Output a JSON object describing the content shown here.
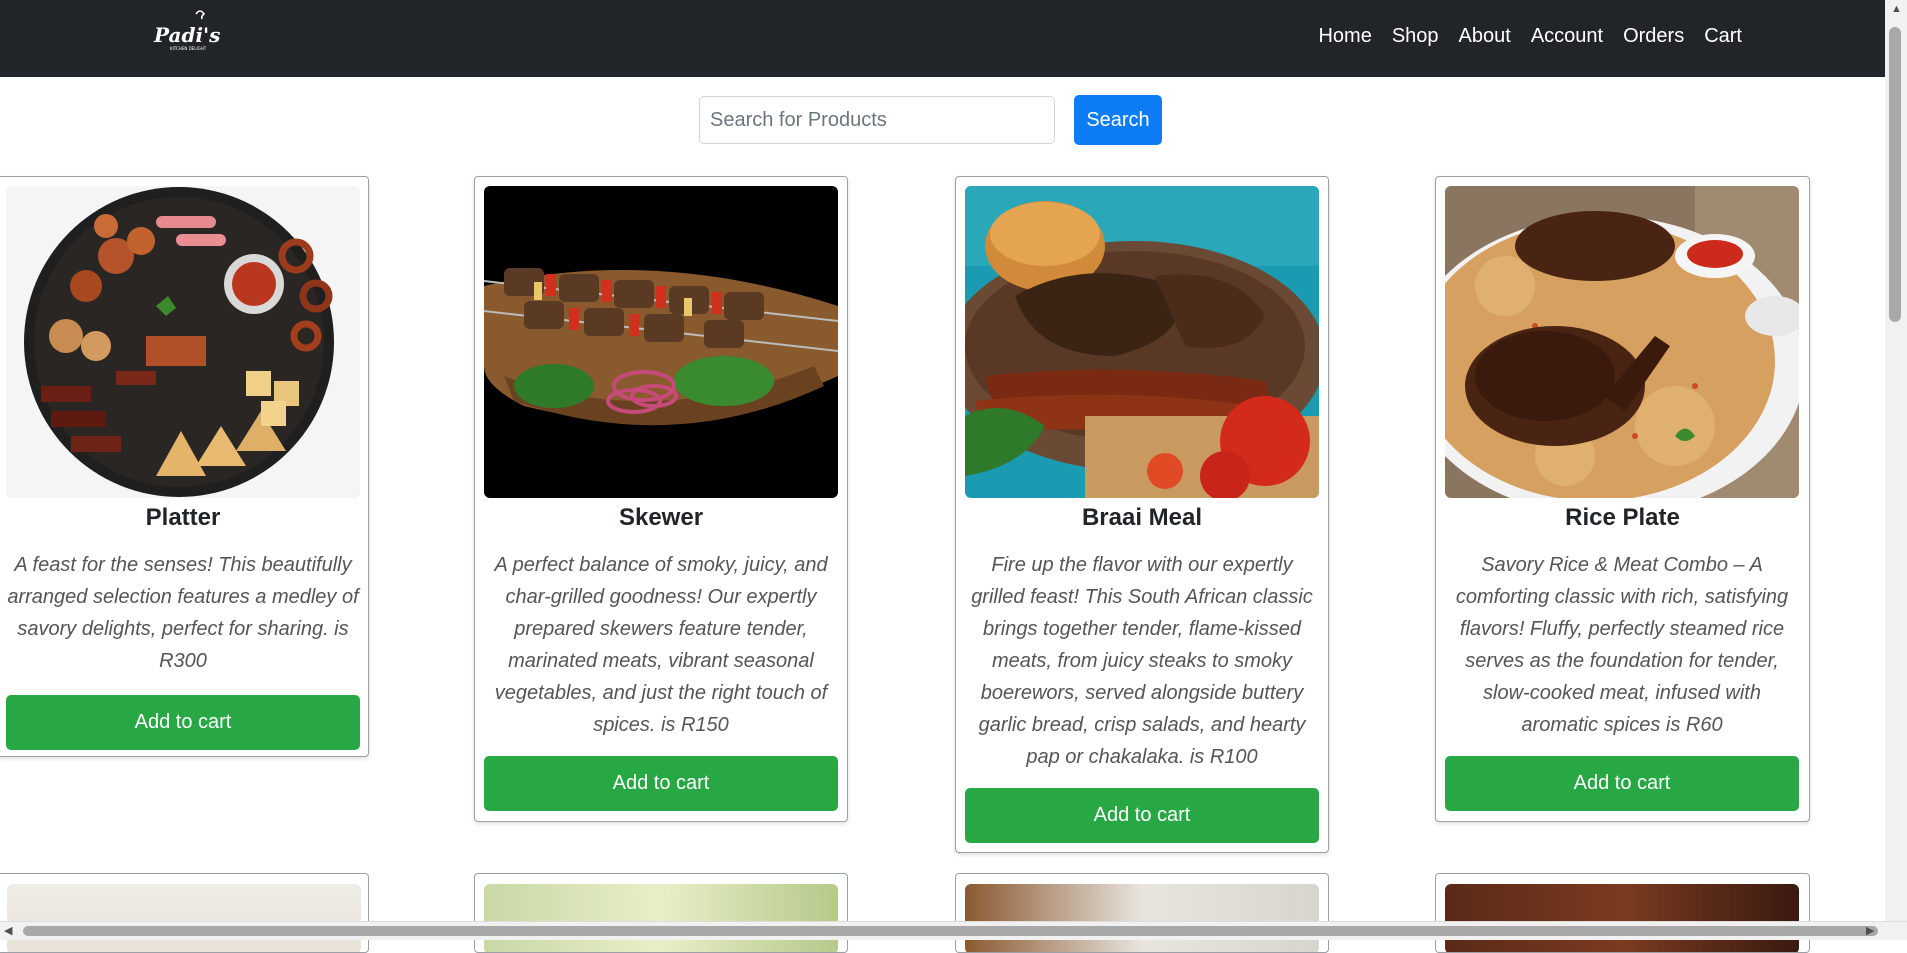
{
  "nav": {
    "logo_text": "Padi's",
    "links": [
      "Home",
      "Shop",
      "About",
      "Account",
      "Orders",
      "Cart"
    ]
  },
  "search": {
    "placeholder": "Search for Products",
    "button_label": "Search"
  },
  "products": [
    {
      "title": "Platter",
      "description": "A feast for the senses! This beautifully arranged selection features a medley of savory delights, perfect for sharing. is R300",
      "button": "Add to cart"
    },
    {
      "title": "Skewer",
      "description": "A perfect balance of smoky, juicy, and char-grilled goodness! Our expertly prepared skewers feature tender, marinated meats, vibrant seasonal vegetables, and just the right touch of spices. is R150",
      "button": "Add to cart"
    },
    {
      "title": "Braai Meal",
      "description": "Fire up the flavor with our expertly grilled feast! This South African classic brings together tender, flame-kissed meats, from juicy steaks to smoky boerewors, served alongside buttery garlic bread, crisp salads, and hearty pap or chakalaka. is R100",
      "button": "Add to cart"
    },
    {
      "title": "Rice Plate",
      "description": "Savory Rice & Meat Combo – A comforting classic with rich, satisfying flavors! Fluffy, perfectly steamed rice serves as the foundation for tender, slow-cooked meat, infused with aromatic spices is R60",
      "button": "Add to cart"
    }
  ],
  "colors": {
    "navbar": "#212529",
    "search_button": "#0d7cf5",
    "add_to_cart": "#28a745"
  }
}
